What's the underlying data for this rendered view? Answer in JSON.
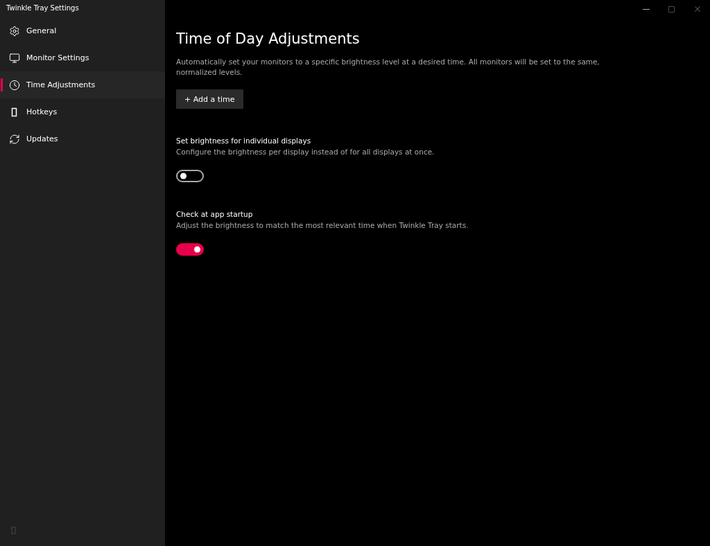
{
  "window": {
    "title": "Twinkle Tray Settings"
  },
  "sidebar": {
    "items": [
      {
        "label": "General",
        "kind": "gear",
        "selected": false
      },
      {
        "label": "Monitor Settings",
        "kind": "monitor",
        "selected": false
      },
      {
        "label": "Time Adjustments",
        "kind": "clock",
        "selected": true
      },
      {
        "label": "Hotkeys",
        "kind": "keys",
        "selected": false
      },
      {
        "label": "Updates",
        "kind": "refresh",
        "selected": false
      }
    ]
  },
  "page": {
    "title": "Time of Day Adjustments",
    "description": "Automatically set your monitors to a specific brightness level at a desired time. All monitors will be set to the same, normalized levels.",
    "add_button": "+ Add a time"
  },
  "settings": [
    {
      "title": "Set brightness for individual displays",
      "description": "Configure the brightness per display instead of for all displays at once.",
      "on": false
    },
    {
      "title": "Check at app startup",
      "description": "Adjust the brightness to match the most relevant time when Twinkle Tray starts.",
      "on": true
    }
  ]
}
